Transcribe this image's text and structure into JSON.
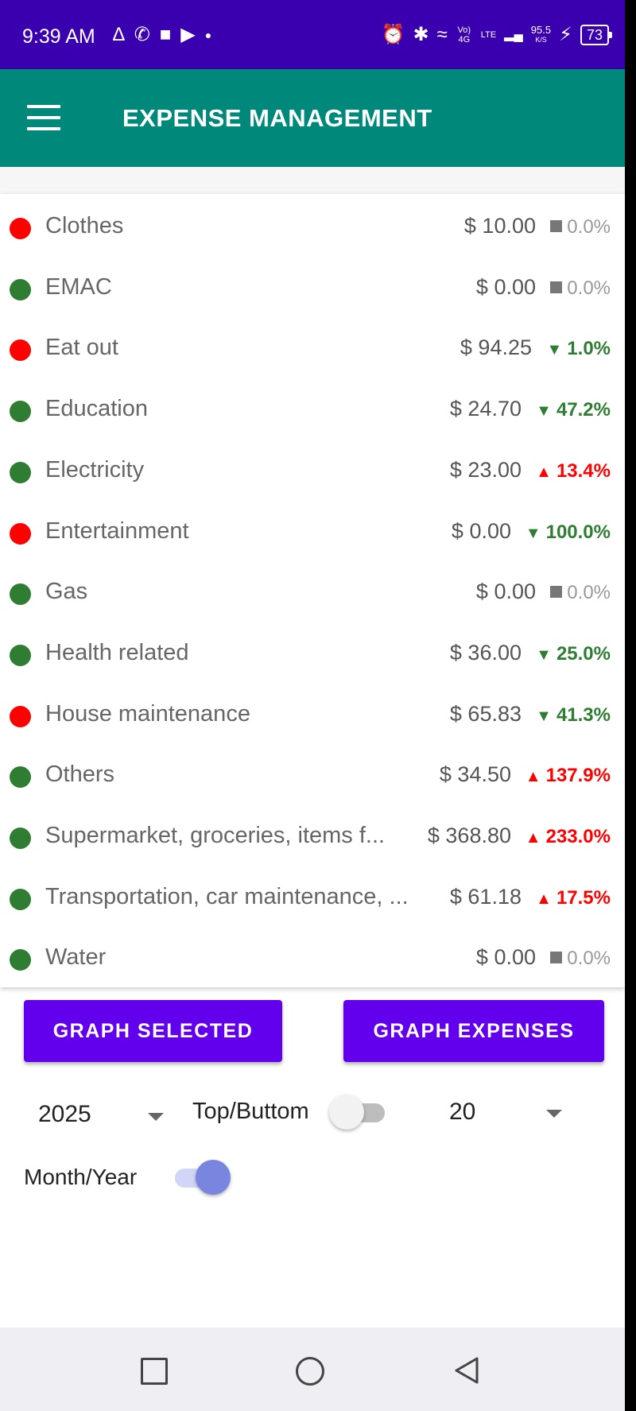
{
  "status_bar": {
    "time": "9:39 AM",
    "left_icons": [
      "airbnb-icon",
      "whatsapp-icon",
      "square-notification-icon",
      "youtube-icon",
      "more-dot-icon"
    ],
    "right_icons": [
      "alarm-icon",
      "bluetooth-icon",
      "wifi-icon",
      "volte-icon",
      "signal-icon",
      "speed-icon",
      "charging-icon"
    ],
    "volte_label": "Vo) 4G",
    "lte_label": "LTE",
    "speed_value": "95.5",
    "speed_unit": "K/S",
    "battery": "73"
  },
  "app_bar": {
    "title": "EXPENSE MANAGEMENT",
    "menu_icon": "hamburger-menu-icon"
  },
  "colors": {
    "status_bar": "#3a00b0",
    "app_bar": "#00897b",
    "button": "#6200ee",
    "dot_red": "#ff0000",
    "dot_green": "#2e7d32",
    "pct_up": "#ff0000",
    "pct_down": "#2e7d32",
    "pct_flat": "#999999"
  },
  "expenses": [
    {
      "category": "Clothes",
      "amount": "$ 10.00",
      "trend": "flat",
      "percent": "0.0%",
      "dot": "red"
    },
    {
      "category": "EMAC",
      "amount": "$ 0.00",
      "trend": "flat",
      "percent": "0.0%",
      "dot": "green"
    },
    {
      "category": "Eat out",
      "amount": "$ 94.25",
      "trend": "down",
      "percent": "1.0%",
      "dot": "red"
    },
    {
      "category": "Education",
      "amount": "$ 24.70",
      "trend": "down",
      "percent": "47.2%",
      "dot": "green"
    },
    {
      "category": "Electricity",
      "amount": "$ 23.00",
      "trend": "up",
      "percent": "13.4%",
      "dot": "green"
    },
    {
      "category": "Entertainment",
      "amount": "$ 0.00",
      "trend": "down",
      "percent": "100.0%",
      "dot": "red"
    },
    {
      "category": "Gas",
      "amount": "$ 0.00",
      "trend": "flat",
      "percent": "0.0%",
      "dot": "green"
    },
    {
      "category": "Health related",
      "amount": "$ 36.00",
      "trend": "down",
      "percent": "25.0%",
      "dot": "green"
    },
    {
      "category": "House maintenance",
      "amount": "$ 65.83",
      "trend": "down",
      "percent": "41.3%",
      "dot": "red"
    },
    {
      "category": "Others",
      "amount": "$ 34.50",
      "trend": "up",
      "percent": "137.9%",
      "dot": "green"
    },
    {
      "category": "Supermarket, groceries, items f...",
      "amount": "$ 368.80",
      "trend": "up",
      "percent": "233.0%",
      "dot": "green"
    },
    {
      "category": "Transportation, car maintenance, ...",
      "amount": "$ 61.18",
      "trend": "up",
      "percent": "17.5%",
      "dot": "green"
    },
    {
      "category": "Water",
      "amount": "$ 0.00",
      "trend": "flat",
      "percent": "0.0%",
      "dot": "green"
    }
  ],
  "buttons": {
    "graph_selected": "GRAPH SELECTED",
    "graph_expenses": "GRAPH EXPENSES"
  },
  "controls": {
    "year_value": "2025",
    "top_bottom_label": "Top/Buttom",
    "top_bottom_on": false,
    "count_value": "20",
    "month_year_label": "Month/Year",
    "month_year_on": true
  },
  "nav_bar": {
    "icons": [
      "recents-square-icon",
      "home-circle-icon",
      "back-triangle-icon"
    ]
  }
}
